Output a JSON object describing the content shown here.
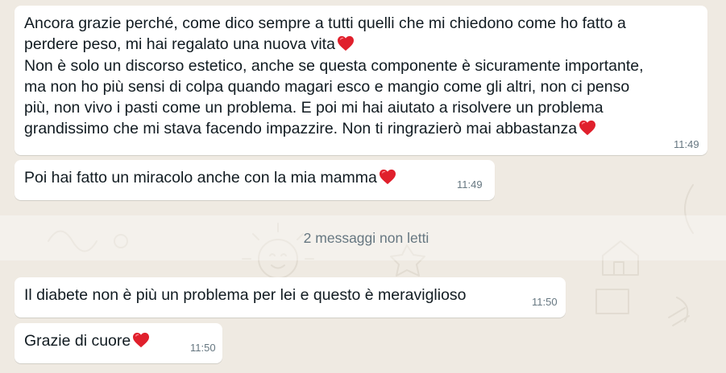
{
  "chat": {
    "messages": [
      {
        "lines": [
          "Ancora grazie perché, come dico sempre a tutti quelli che mi chiedono come ho fatto a",
          "perdere peso, mi hai regalato una nuova vita",
          "Non è solo un discorso estetico, anche se questa componente è sicuramente importante,",
          "ma non ho più sensi di colpa quando magari esco e mangio come gli altri, non ci penso",
          "più, non vivo i pasti come un problema. E poi mi hai aiutato a risolvere un problema",
          "grandissimo che mi stava facendo impazzire. Non ti ringrazierò mai abbastanza"
        ],
        "time": "11:49"
      },
      {
        "text": "Poi hai fatto un miracolo anche con la mia mamma",
        "time": "11:49"
      },
      {
        "text": "Il diabete non è più un problema per lei e questo è meraviglioso",
        "time": "11:50"
      },
      {
        "text": "Grazie di cuore",
        "time": "11:50"
      }
    ],
    "unread_divider": "2 messaggi non letti"
  },
  "colors": {
    "background": "#efeae2",
    "bubble": "#ffffff",
    "text": "#111b21",
    "meta": "#667781",
    "heart": "#e0202c"
  },
  "icons": {
    "heart": "heart-emoji-icon"
  }
}
